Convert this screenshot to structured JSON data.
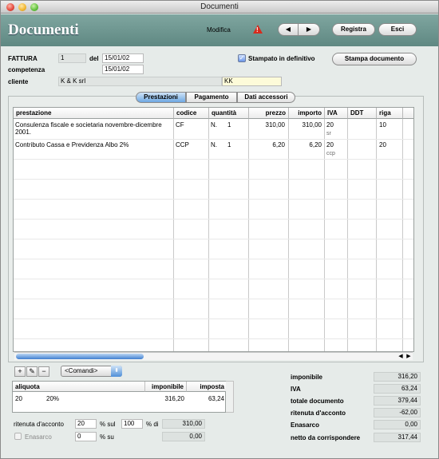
{
  "window": {
    "title": "Documenti"
  },
  "header": {
    "title": "Documenti",
    "modifica": "Modifica",
    "warning_glyph": "!",
    "nav_prev": "◀",
    "nav_next": "▶",
    "registra": "Registra",
    "esci": "Esci"
  },
  "doc": {
    "type_label": "FATTURA",
    "number": "1",
    "del_label": "del",
    "date": "15/01/02",
    "competenza_label": "competenza",
    "competenza": "15/01/02",
    "cliente_label": "cliente",
    "cliente_name": "K & K srl",
    "cliente_code": "KK",
    "stampato_label": "Stampato in definitivo",
    "stampato_checked": true,
    "stampa_button": "Stampa documento"
  },
  "tabs": [
    {
      "label": "Prestazioni",
      "selected": true
    },
    {
      "label": "Pagamento",
      "selected": false
    },
    {
      "label": "Dati accessori",
      "selected": false
    }
  ],
  "grid": {
    "columns": [
      "prestazione",
      "codice",
      "quantità",
      "prezzo",
      "importo",
      "IVA",
      "DDT",
      "riga"
    ],
    "rows": [
      {
        "prestazione": "Consulenza fiscale e societaria novembre-dicembre 2001.",
        "codice": "CF",
        "unit": "N.",
        "quantita": "1",
        "prezzo": "310,00",
        "importo": "310,00",
        "iva": "20",
        "iva_code": "sr",
        "ddt": "",
        "riga": "10"
      },
      {
        "prestazione": "Contributo Cassa e Previdenza Albo 2%",
        "codice": "CCP",
        "unit": "N.",
        "quantita": "1",
        "prezzo": "6,20",
        "importo": "6,20",
        "iva": "20",
        "iva_code": "ccp",
        "ddt": "",
        "riga": "20"
      }
    ]
  },
  "toolbar": {
    "add": "+",
    "edit": "✎",
    "remove": "−",
    "comandi": "<Comandi>"
  },
  "aliquote": {
    "columns": [
      "aliquota",
      "imponibile",
      "imposta"
    ],
    "rows": [
      {
        "aliquota": "20",
        "descr": "20%",
        "imponibile": "316,20",
        "imposta": "63,24"
      }
    ]
  },
  "ritenuta": {
    "label": "ritenuta d'acconto",
    "perc": "20",
    "sul_label": "% sul",
    "base_perc": "100",
    "di_label": "% di",
    "value": "310,00"
  },
  "enasarco": {
    "label": "Enasarco",
    "perc": "0",
    "su_label": "% su",
    "value": "0,00",
    "checked": false
  },
  "totals": [
    {
      "label": "imponibile",
      "value": "316,20"
    },
    {
      "label": "IVA",
      "value": "63,24"
    },
    {
      "label": "totale documento",
      "value": "379,44"
    },
    {
      "label": "ritenuta d'acconto",
      "value": "-62,00"
    },
    {
      "label": "Enasarco",
      "value": "0,00"
    },
    {
      "label": "netto da corrispondere",
      "value": "317,44"
    }
  ]
}
